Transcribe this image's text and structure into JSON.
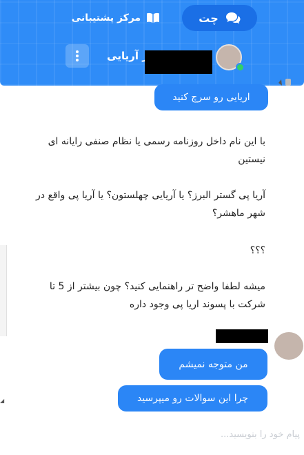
{
  "header": {
    "tabs": {
      "chat_label": "چت",
      "support_label": "مرکز پشتیبانی"
    },
    "title": "از آریایی"
  },
  "messages": {
    "agent_bubble": "اریایی رو سرچ کنید",
    "user_lines": [
      "با این نام داخل روزنامه رسمی یا نظام صنفی رایانه ای نیستین",
      "آریا پی گستر البرز؟ یا آریایی چهلستون؟ یا آریا پی واقع در شهر ماهشر؟",
      "؟؟؟",
      "میشه لطفا واضح تر راهنمایی کنید؟ چون بیشتر از 5 تا شرکت با پسوند اریا پی وجود داره"
    ],
    "reply_bubbles": [
      "من متوجه نمیشم",
      "چرا این سوالات رو میپرسید"
    ]
  },
  "composer": {
    "placeholder": "پیام خود را بنویسید..."
  },
  "colors": {
    "header_bg": "#2f8cf7",
    "active_tab_bg": "#1a6fe6",
    "bubble_blue": "#2b86f6",
    "online_green": "#31d067"
  },
  "icons": {
    "chat_tab": "chat-bubbles-icon",
    "support_tab": "book-icon",
    "menu": "vertical-dots-icon"
  }
}
